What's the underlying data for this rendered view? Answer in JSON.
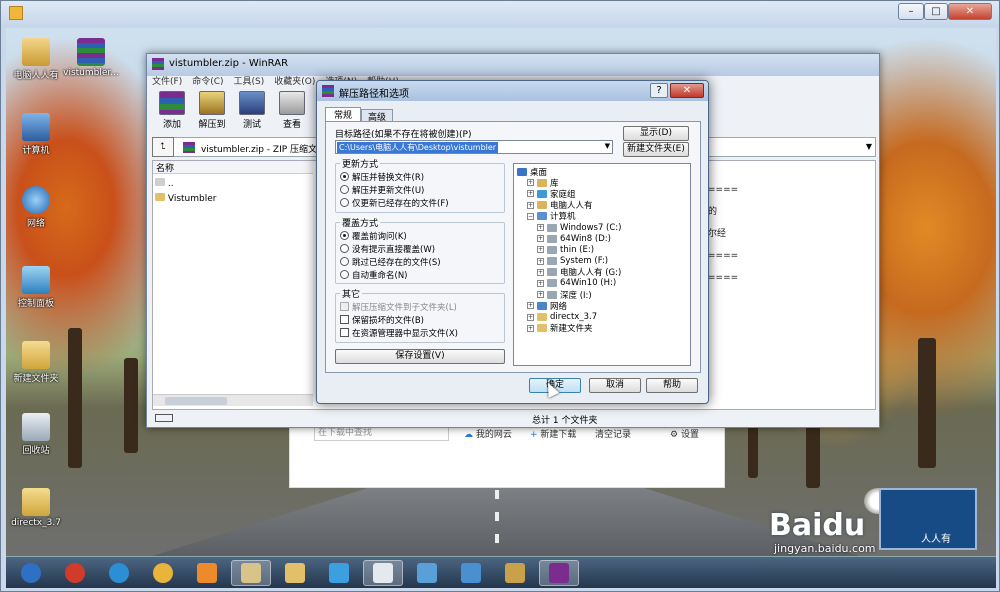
{
  "outer_window": {
    "controls": {
      "minimize": "–",
      "maximize": "□",
      "close": "✕"
    }
  },
  "desktop": {
    "icons": [
      {
        "label": "电脑人人有",
        "name": "user-folder-icon"
      },
      {
        "label": "vistumbler...",
        "name": "winrar-archive-icon"
      },
      {
        "label": "计算机",
        "name": "computer-icon"
      },
      {
        "label": "网络",
        "name": "network-icon"
      },
      {
        "label": "控制面板",
        "name": "control-panel-icon"
      },
      {
        "label": "新建文件夹",
        "name": "folder-icon"
      },
      {
        "label": "回收站",
        "name": "recycle-bin-icon"
      },
      {
        "label": "directx_3.7",
        "name": "folder-icon"
      }
    ]
  },
  "baidu_panel": {
    "search_placeholder": "在下载中查找",
    "my_cloud": "我的网云",
    "new_download": "新建下载",
    "clear_records": "清空记录",
    "settings": "设置"
  },
  "watermark": {
    "brand": "Baidu",
    "jingyan": "经验",
    "url": "jingyan.baidu.com",
    "logo_text": "人人有"
  },
  "winrar": {
    "title": "vistumbler.zip - WinRAR",
    "menu": [
      "文件(F)",
      "命令(C)",
      "工具(S)",
      "收藏夹(O)",
      "选项(N)",
      "帮助(H)"
    ],
    "toolbar": [
      "添加",
      "解压到",
      "测试",
      "查看"
    ],
    "address": "vistumbler.zip - ZIP 压缩文件",
    "list_header": "名称",
    "rows": [
      "..",
      "Vistumbler"
    ],
    "status": "总计 1 个文件夹",
    "right_text": [
      "====",
      "的",
      "尔经",
      "====",
      "===="
    ]
  },
  "dialog": {
    "title": "解压路径和选项",
    "tabs": [
      "常规",
      "高级"
    ],
    "dest_label": "目标路径(如果不存在将被创建)(P)",
    "dest_value": "C:\\Users\\电脑人人有\\Desktop\\vistumbler",
    "show_button": "显示(D)",
    "new_folder_button": "新建文件夹(E)",
    "update_group": {
      "title": "更新方式",
      "options": [
        "解压并替换文件(R)",
        "解压并更新文件(U)",
        "仅更新已经存在的文件(F)"
      ],
      "selected": 0
    },
    "overwrite_group": {
      "title": "覆盖方式",
      "options": [
        "覆盖前询问(K)",
        "没有提示直接覆盖(W)",
        "跳过已经存在的文件(S)",
        "自动重命名(N)"
      ],
      "selected": 0
    },
    "misc_group": {
      "title": "其它",
      "options": [
        "解压压缩文件到子文件夹(L)",
        "保留损坏的文件(B)",
        "在资源管理器中显示文件(X)"
      ],
      "disabled": [
        0
      ]
    },
    "save_button": "保存设置(V)",
    "tree": [
      {
        "label": "桌面",
        "level": 0,
        "icon": "desktop-icon",
        "color": "#3b73c9"
      },
      {
        "label": "库",
        "level": 1,
        "icon": "library-icon",
        "color": "#d9b45a"
      },
      {
        "label": "家庭组",
        "level": 1,
        "icon": "homegroup-icon",
        "color": "#3b9bd9"
      },
      {
        "label": "电脑人人有",
        "level": 1,
        "icon": "user-folder-icon",
        "color": "#d9b45a"
      },
      {
        "label": "计算机",
        "level": 1,
        "icon": "computer-icon",
        "color": "#5c8ed0"
      },
      {
        "label": "Windows7 (C:)",
        "level": 2,
        "icon": "drive-icon",
        "color": "#9aa6b2"
      },
      {
        "label": "64Win8 (D:)",
        "level": 2,
        "icon": "drive-icon",
        "color": "#9aa6b2"
      },
      {
        "label": "thin (E:)",
        "level": 2,
        "icon": "drive-icon",
        "color": "#9aa6b2"
      },
      {
        "label": "System (F:)",
        "level": 2,
        "icon": "drive-icon",
        "color": "#9aa6b2"
      },
      {
        "label": "电脑人人有 (G:)",
        "level": 2,
        "icon": "drive-icon",
        "color": "#9aa6b2"
      },
      {
        "label": "64Win10 (H:)",
        "level": 2,
        "icon": "drive-icon",
        "color": "#9aa6b2"
      },
      {
        "label": "深度 (I:)",
        "level": 2,
        "icon": "drive-icon",
        "color": "#9aa6b2"
      },
      {
        "label": "网络",
        "level": 1,
        "icon": "network-icon",
        "color": "#4a86c9"
      },
      {
        "label": "directx_3.7",
        "level": 1,
        "icon": "folder-icon",
        "color": "#e2c069"
      },
      {
        "label": "新建文件夹",
        "level": 1,
        "icon": "folder-icon",
        "color": "#e2c069"
      }
    ],
    "ok": "确定",
    "cancel": "取消",
    "help": "帮助"
  },
  "taskbar": {
    "items": [
      "start-orb-icon",
      "app-red-icon",
      "ie-icon",
      "chrome-icon",
      "media-player-icon",
      "explorer-icon",
      "folder-icon",
      "qq-browser-icon",
      "document-icon",
      "paint-icon",
      "monitor-icon",
      "paintbrush-icon",
      "winrar-icon"
    ]
  }
}
